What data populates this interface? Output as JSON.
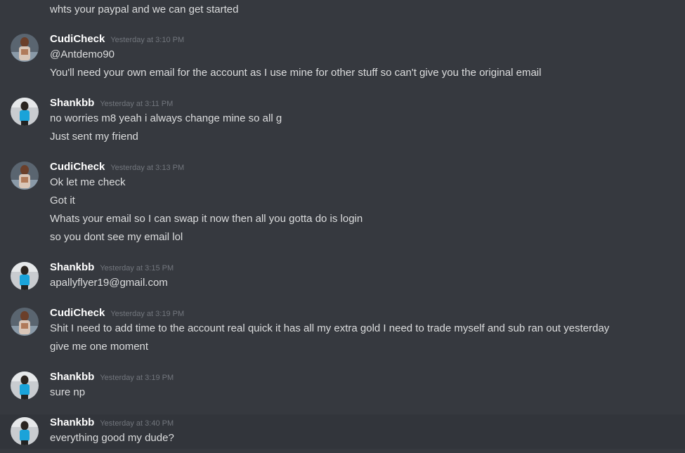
{
  "messages": [
    {
      "type": "line",
      "text": "whts your paypal and we can get started"
    },
    {
      "type": "header",
      "author": "CudiCheck",
      "time": "Yesterday at 3:10 PM",
      "avatar": "cudi"
    },
    {
      "type": "line",
      "text": "@Antdemo90"
    },
    {
      "type": "line",
      "text": "You'll need your own email for the account as I use mine for other stuff so can't give you the original email"
    },
    {
      "type": "header",
      "author": "Shankbb",
      "time": "Yesterday at 3:11 PM",
      "avatar": "shank"
    },
    {
      "type": "line",
      "text": "no worries m8 yeah i always change mine so all g"
    },
    {
      "type": "line",
      "text": "Just sent my friend"
    },
    {
      "type": "header",
      "author": "CudiCheck",
      "time": "Yesterday at 3:13 PM",
      "avatar": "cudi"
    },
    {
      "type": "line",
      "text": "Ok let me check"
    },
    {
      "type": "line",
      "text": "Got it"
    },
    {
      "type": "line",
      "text": "Whats your email so I can swap it now then all you gotta do is login"
    },
    {
      "type": "line",
      "text": "so you dont see my email lol"
    },
    {
      "type": "header",
      "author": "Shankbb",
      "time": "Yesterday at 3:15 PM",
      "avatar": "shank"
    },
    {
      "type": "line",
      "text": "apallyflyer19@gmail.com"
    },
    {
      "type": "header",
      "author": "CudiCheck",
      "time": "Yesterday at 3:19 PM",
      "avatar": "cudi"
    },
    {
      "type": "line",
      "text": "Shit I need to add time to the account real quick it has all my extra gold I need to trade myself and sub ran out yesterday"
    },
    {
      "type": "line",
      "text": "give me one moment"
    },
    {
      "type": "header",
      "author": "Shankbb",
      "time": "Yesterday at 3:19 PM",
      "avatar": "shank"
    },
    {
      "type": "line",
      "text": "sure np"
    },
    {
      "type": "header",
      "author": "Shankbb",
      "time": "Yesterday at 3:40 PM",
      "avatar": "shank"
    },
    {
      "type": "line",
      "text": "everything good my dude?"
    }
  ],
  "colors": {
    "background": "#36393f",
    "hover_row": "#32353b",
    "username": "#ffffff",
    "text": "#dcddde",
    "timestamp": "#72767d"
  }
}
